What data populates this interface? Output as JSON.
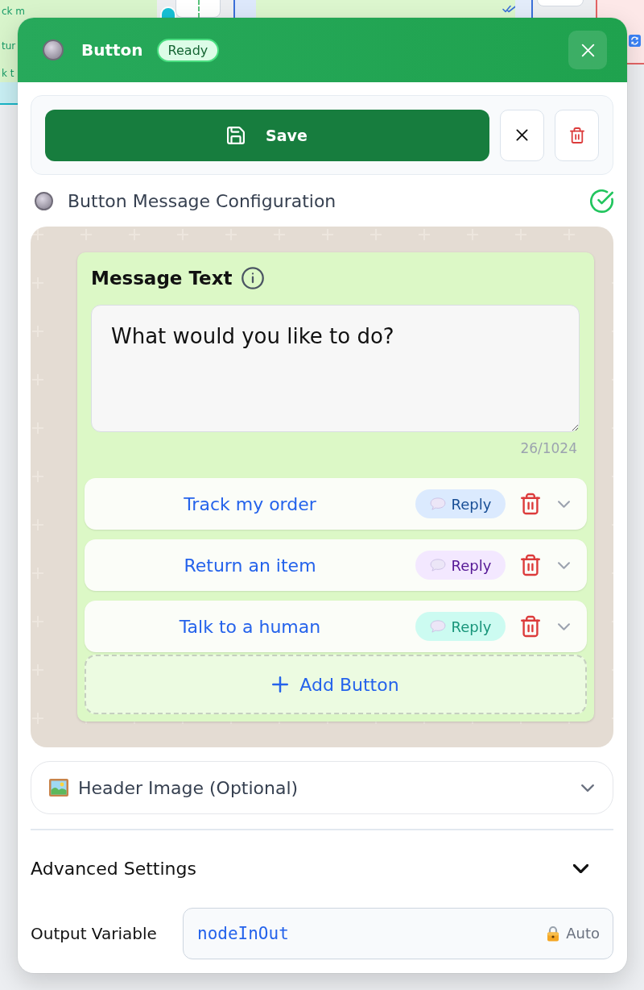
{
  "canvas": {
    "node_texts": [
      "ck m",
      "tur",
      "k t"
    ]
  },
  "panel": {
    "title": "Button",
    "status": "Ready"
  },
  "toolbar": {
    "save_label": "Save"
  },
  "section": {
    "title": "Button Message Configuration",
    "valid": true
  },
  "message": {
    "label": "Message Text",
    "text": "What would you like to do?",
    "counter": "26/1024"
  },
  "reply_buttons": [
    {
      "label": "Track my order",
      "badge": "Reply",
      "color": "#dbeafe",
      "expanded": false
    },
    {
      "label": "Return an item",
      "badge": "Reply",
      "color": "#f3e8ff",
      "expanded": false
    },
    {
      "label": "Talk to a human",
      "badge": "Reply",
      "color": "#ccfbf1",
      "expanded": false
    }
  ],
  "add_button": {
    "label": "Add Button"
  },
  "header_image": {
    "label": "Header Image (Optional)",
    "expanded": false
  },
  "advanced_settings": {
    "label": "Advanced Settings",
    "expanded": false
  },
  "output_variable": {
    "label": "Output Variable",
    "value": "nodeInOut",
    "hint": "Auto"
  }
}
